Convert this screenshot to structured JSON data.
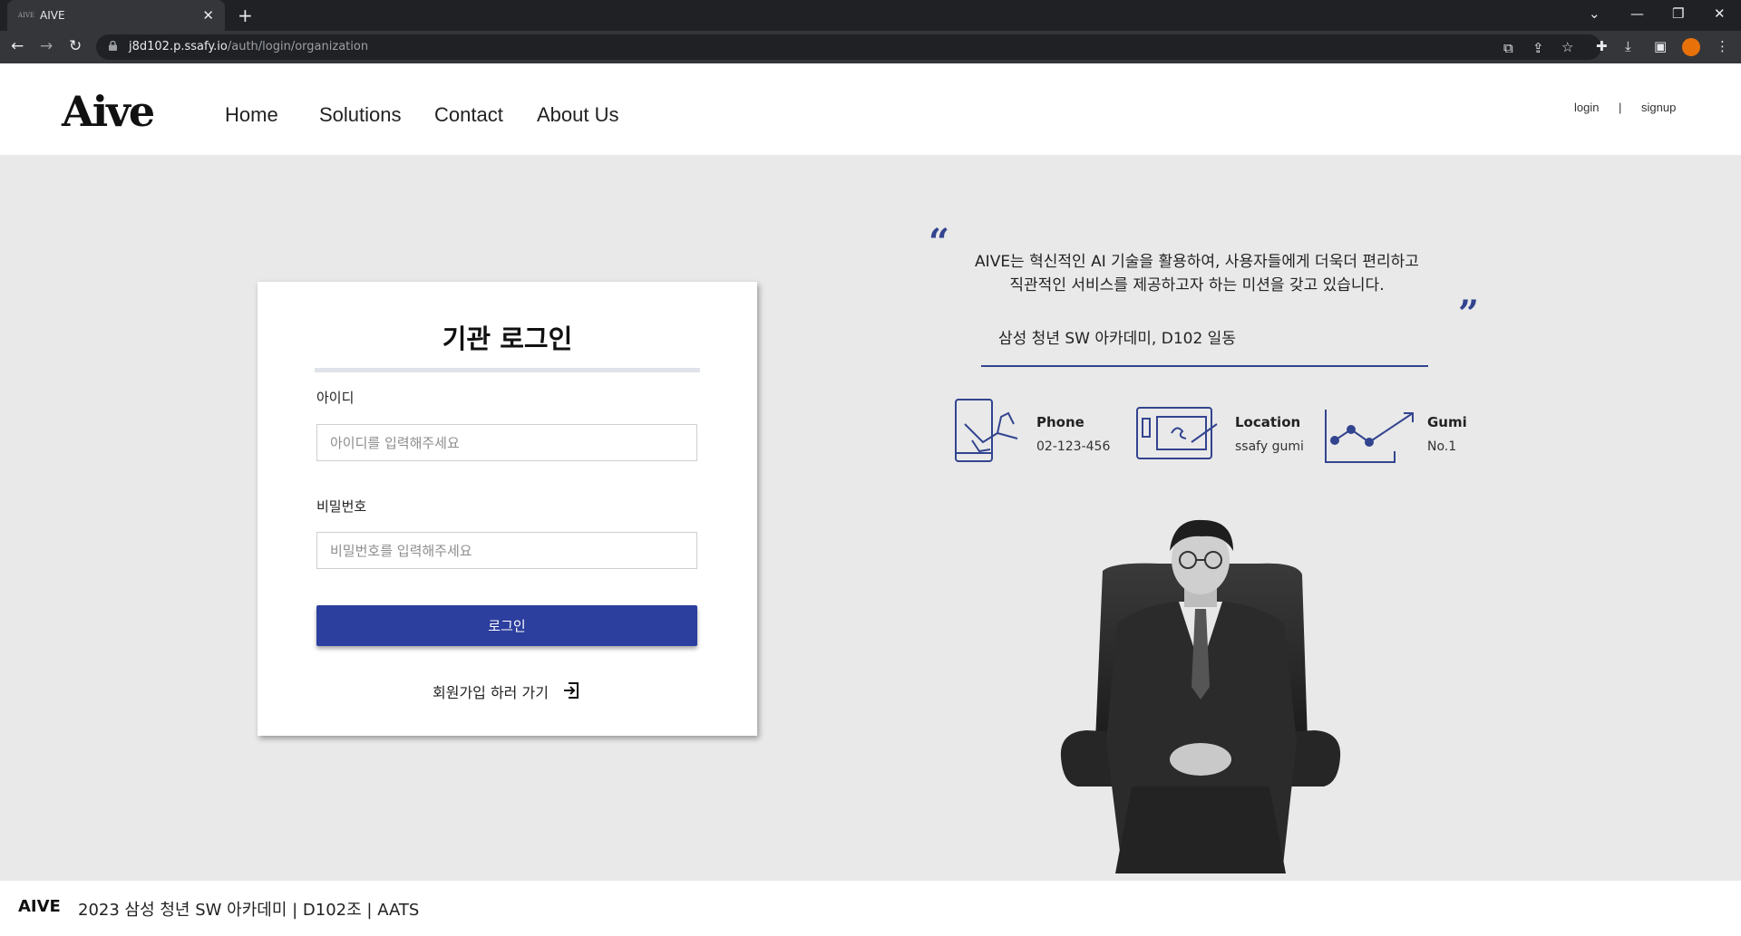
{
  "browser": {
    "tab_title": "AIVE",
    "favicon_text": "AIVE",
    "url_host": "j8d102.p.ssafy.io",
    "url_path": "/auth/login/organization"
  },
  "header": {
    "logo": "Aive",
    "nav": [
      "Home",
      "Solutions",
      "Contact",
      "About Us"
    ],
    "login": "login",
    "separator": "|",
    "signup": "signup"
  },
  "login_card": {
    "title": "기관 로그인",
    "id_label": "아이디",
    "id_placeholder": "아이디를 입력해주세요",
    "pw_label": "비밀번호",
    "pw_placeholder": "비밀번호를 입력해주세요",
    "submit": "로그인",
    "signup_link": "회원가입 하러 가기"
  },
  "quote": {
    "line1": "AIVE는 혁신적인 AI 기술을 활용하여, 사용자들에게 더욱더 편리하고",
    "line2": "직관적인 서비스를 제공하고자 하는 미션을 갖고 있습니다.",
    "author": "삼성 청년 SW 아카데미, D102 일동"
  },
  "info": [
    {
      "title": "Phone",
      "value": "02-123-456",
      "icon": "phone-hand-icon"
    },
    {
      "title": "Location",
      "value": "ssafy gumi",
      "icon": "tablet-pen-icon"
    },
    {
      "title": "Gumi",
      "value": "No.1",
      "icon": "line-chart-icon"
    }
  ],
  "footer": {
    "brand": "AIVE",
    "text": "2023 삼성 청년 SW 아카데미 | D102조 | AATS"
  },
  "colors": {
    "accent": "#2c3e9e",
    "quote_accent": "#33448f",
    "background": "#e9e9e9"
  }
}
